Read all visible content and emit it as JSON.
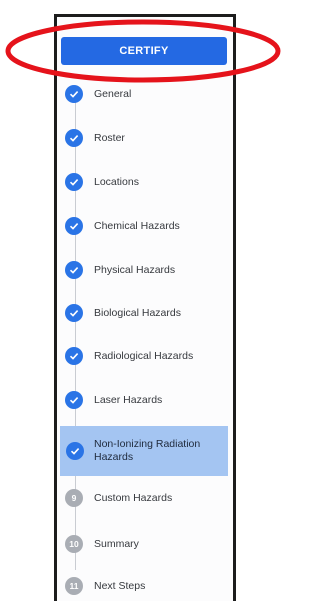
{
  "certify": {
    "label": "CERTIFY"
  },
  "steps": [
    {
      "label": "General",
      "status": "complete",
      "icon": "check-icon"
    },
    {
      "label": "Roster",
      "status": "complete",
      "icon": "check-icon"
    },
    {
      "label": "Locations",
      "status": "complete",
      "icon": "check-icon"
    },
    {
      "label": "Chemical Hazards",
      "status": "complete",
      "icon": "check-icon"
    },
    {
      "label": "Physical Hazards",
      "status": "complete",
      "icon": "check-icon"
    },
    {
      "label": "Biological Hazards",
      "status": "complete",
      "icon": "check-icon"
    },
    {
      "label": "Radiological Hazards",
      "status": "complete",
      "icon": "check-icon"
    },
    {
      "label": "Laser Hazards",
      "status": "complete",
      "icon": "check-icon"
    },
    {
      "label": "Non-Ionizing Radiation Hazards",
      "status": "active",
      "icon": "check-icon"
    },
    {
      "label": "Custom Hazards",
      "status": "pending",
      "number": "9"
    },
    {
      "label": "Summary",
      "status": "pending",
      "number": "10"
    },
    {
      "label": "Next Steps",
      "status": "pending",
      "number": "11"
    }
  ],
  "colors": {
    "primary": "#2469e3",
    "step_complete": "#2a74e6",
    "step_pending": "#a9adb4",
    "active_bg": "#a4c5f2",
    "highlight": "#e5131b"
  }
}
